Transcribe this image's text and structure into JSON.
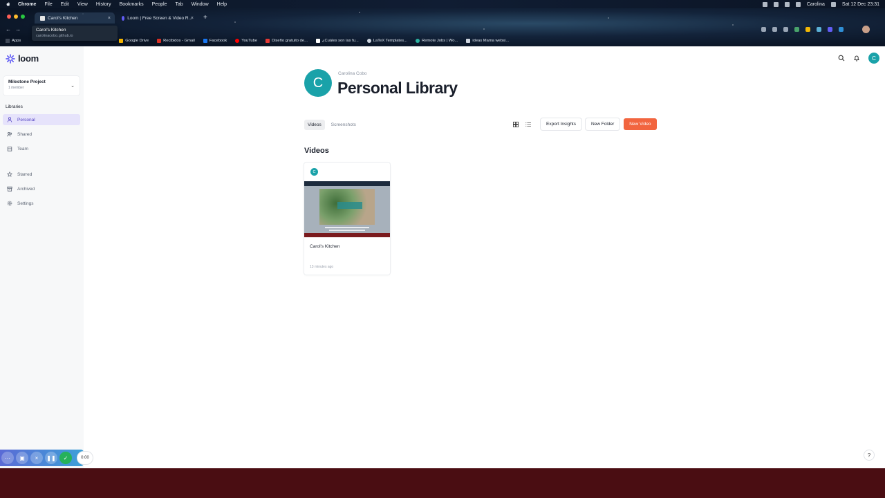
{
  "menubar": {
    "app": "Chrome",
    "menus": [
      "File",
      "Edit",
      "View",
      "History",
      "Bookmarks",
      "People",
      "Tab",
      "Window",
      "Help"
    ],
    "user": "Carolina",
    "datetime": "Sat 12 Dec  23:31"
  },
  "browser": {
    "tabs": [
      {
        "title": "Carol's Kitchen"
      },
      {
        "title": "Loom | Free Screen & Video R..."
      }
    ],
    "tooltip": {
      "title": "Carol's Kitchen",
      "url": "carolinacobo.github.io"
    },
    "bookmarks": [
      "Apps",
      "Google Drive",
      "Recibidos - Gmail",
      "Facebook",
      "YouTube",
      "Diseño gratuito de...",
      "¿Cuáles son las fu...",
      "LaTeX Templates...",
      "Remote Jobs | Wo...",
      "ideas Mama websi..."
    ]
  },
  "app": {
    "logo_text": "loom",
    "workspace": {
      "name": "Milestone Project",
      "members": "1 member"
    },
    "libraries_heading": "Libraries",
    "nav": [
      {
        "label": "Personal"
      },
      {
        "label": "Shared"
      },
      {
        "label": "Team"
      },
      {
        "label": "Starred"
      },
      {
        "label": "Archived"
      },
      {
        "label": "Settings"
      }
    ],
    "user_initial": "C",
    "owner_name": "Carolina Cobo",
    "library_title": "Personal Library",
    "subtabs": [
      "Videos",
      "Screenshots"
    ],
    "buttons": {
      "export": "Export Insights",
      "new_folder": "New Folder",
      "new_video": "New Video"
    },
    "section_title": "Videos",
    "videos": [
      {
        "title": "Carol's Kitchen",
        "time": "13 minutes ago",
        "owner_initial": "C"
      }
    ],
    "help_label": "?",
    "recording": {
      "timer": "0:00"
    }
  },
  "colors": {
    "accent": "#5243c2",
    "primary_button": "#f2653f",
    "avatar": "#1aa2a9"
  }
}
